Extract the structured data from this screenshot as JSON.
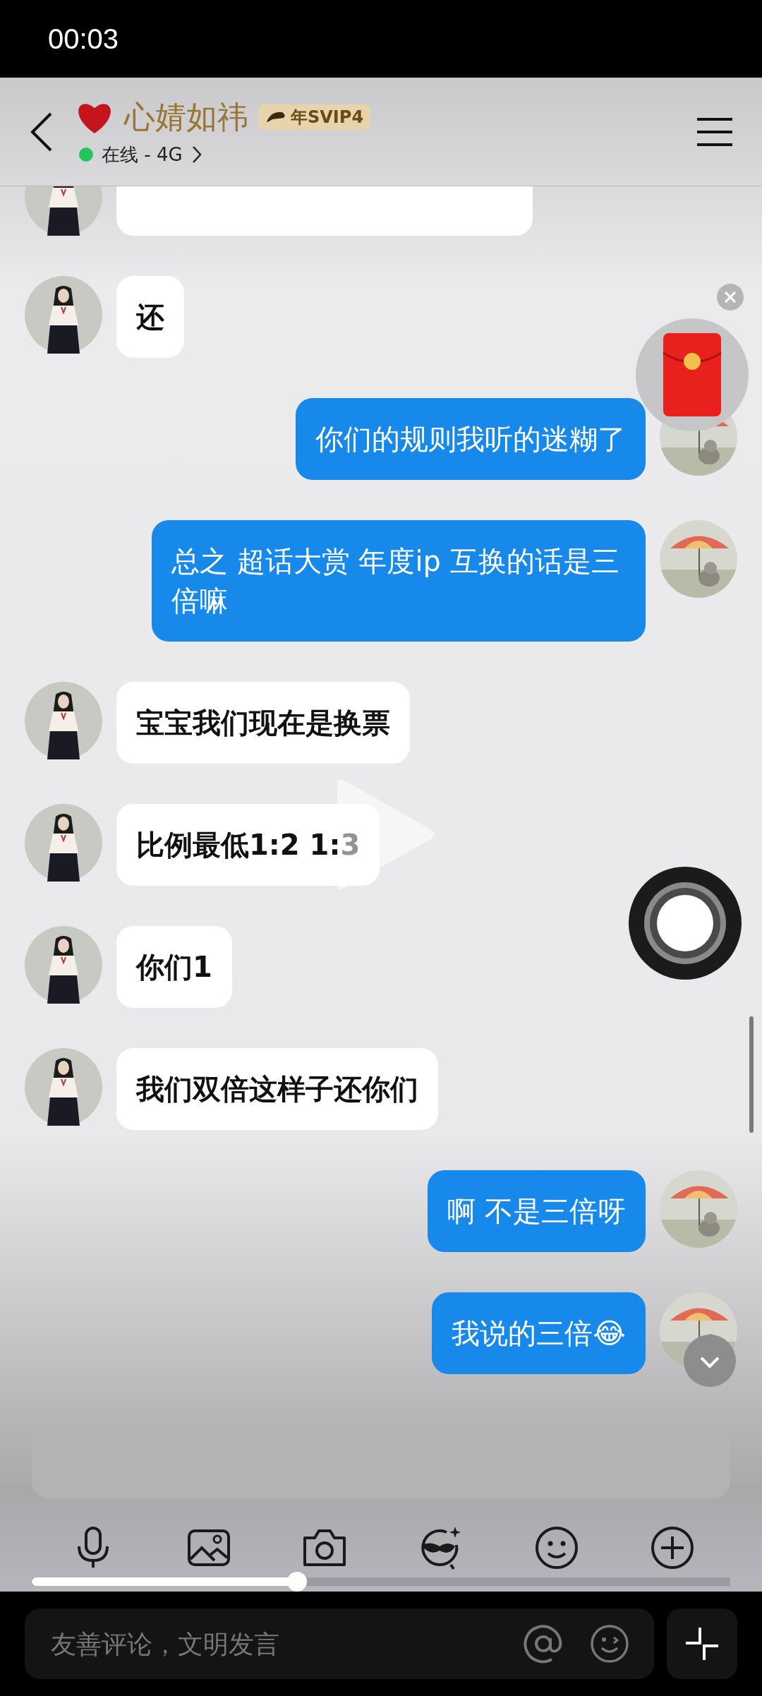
{
  "status_bar": {
    "time": "00:03"
  },
  "header": {
    "name": "心婧如祎",
    "badge": "年SVIP4",
    "status": "在线 - 4G",
    "online": true
  },
  "messages": [
    {
      "outgoing": false,
      "kind": "cut"
    },
    {
      "outgoing": false,
      "kind": "text",
      "text": "还"
    },
    {
      "outgoing": true,
      "kind": "text",
      "text": "你们的规则我听的迷糊了"
    },
    {
      "outgoing": true,
      "kind": "text",
      "text": "总之 超话大赏 年度ip 互换的话是三倍嘛"
    },
    {
      "outgoing": false,
      "kind": "text",
      "text": "宝宝我们现在是换票"
    },
    {
      "outgoing": false,
      "kind": "text",
      "text": "比例最低1:2 1:3"
    },
    {
      "outgoing": false,
      "kind": "text",
      "text": "你们1"
    },
    {
      "outgoing": false,
      "kind": "text",
      "text": "我们双倍这样子还你们"
    },
    {
      "outgoing": true,
      "kind": "text",
      "text": "啊 不是三倍呀"
    },
    {
      "outgoing": true,
      "kind": "text",
      "text": "我说的三倍😂"
    }
  ],
  "video_progress": {
    "level": 0.38
  },
  "comment_bar": {
    "placeholder": "友善评论，文明发言"
  }
}
